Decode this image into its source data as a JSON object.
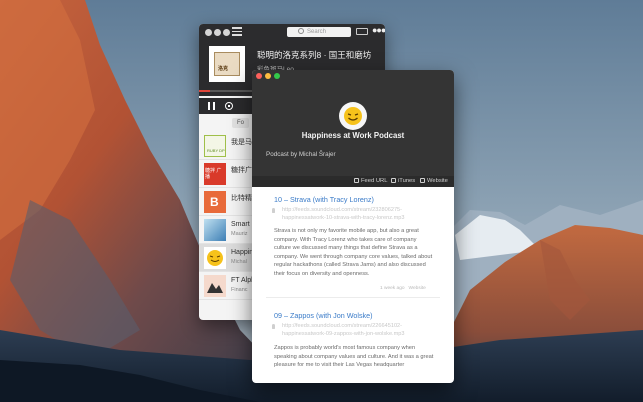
{
  "player": {
    "search_placeholder": "Search",
    "now_playing_title": "聪明的洛克系列8 · 国王和磨坊",
    "now_playing_author": "彩色斑马Leo",
    "art_label": "洛克",
    "progress": 0.06,
    "tabs": [
      "Fo"
    ],
    "podcasts": [
      {
        "name": "我是马",
        "sub": "",
        "thumb": "Ruby-ish-green",
        "badge": "RUBY DP"
      },
      {
        "name": "糖拌广",
        "sub": "",
        "thumb": "red",
        "badge": "糖拌 广播"
      },
      {
        "name": "比特精",
        "sub": "",
        "thumb": "orange",
        "badge": "B"
      },
      {
        "name": "Smart",
        "sub": "Mauriz",
        "thumb": "blue"
      },
      {
        "name": "Happin",
        "sub": "Michal",
        "thumb": "smile"
      },
      {
        "name": "FT Alph",
        "sub": "Financ",
        "thumb": "pink"
      }
    ]
  },
  "detail": {
    "title": "Happiness at Work Podcast",
    "author": "Podcast by Michal Šrajer",
    "links": [
      "Feed URL",
      "iTunes",
      "Website"
    ],
    "episodes": [
      {
        "title": "10 – Strava (with Tracy Lorenz)",
        "url": "http://feeds.soundcloud.com/stream/232806275-happinessatwork-10-strava-with-tracy-lorenz.mp3",
        "desc": "Strava is not only my favorite mobile app, but also a great company. With Tracy Lorenz who takes care of company culture we discussed many things that define Strava as a company. We went through company core values, talked about regular hackathons (called Strava Jams) and also discussed their focus on diversity and openness.",
        "age": "1 week ago",
        "link": "Website"
      },
      {
        "title": "09 – Zappos (with Jon Wolske)",
        "url": "http://feeds.soundcloud.com/stream/226645102-happinessatwork-09-zappos-with-jon-wolske.mp3",
        "desc": "Zappos is probably world's most famous company when speaking about company values and culture. And it was a great pleasure for me to visit their Las Vegas headquarter",
        "age": "",
        "link": ""
      }
    ]
  }
}
